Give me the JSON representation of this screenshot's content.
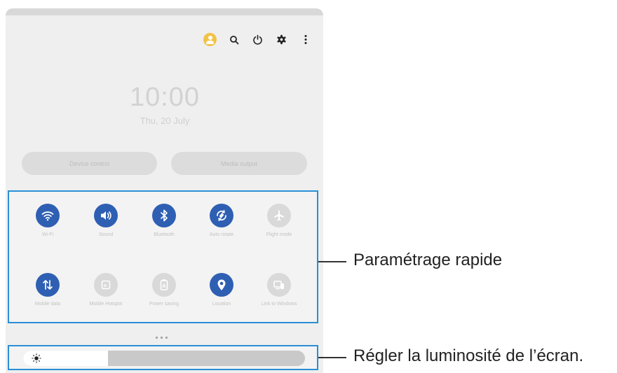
{
  "panel": {
    "top_icons": [
      "account-icon",
      "search-icon",
      "power-icon",
      "settings-gear-icon",
      "more-vertical-icon"
    ],
    "clock": {
      "time": "10:00",
      "date": "Thu, 20 July"
    },
    "buttons": {
      "device_control": "Device control",
      "media_output": "Media output"
    },
    "quick_settings": [
      {
        "label": "Wi-Fi",
        "state": "on",
        "icon": "wifi-icon"
      },
      {
        "label": "Sound",
        "state": "on",
        "icon": "sound-icon"
      },
      {
        "label": "Bluetooth",
        "state": "on",
        "icon": "bluetooth-icon"
      },
      {
        "label": "Auto rotate",
        "state": "on",
        "icon": "auto-rotate-icon"
      },
      {
        "label": "Flight mode",
        "state": "off",
        "icon": "airplane-icon"
      },
      {
        "label": "Mobile data",
        "state": "on",
        "icon": "mobile-data-icon"
      },
      {
        "label": "Mobile Hotspot",
        "state": "off",
        "icon": "hotspot-icon"
      },
      {
        "label": "Power saving",
        "state": "off",
        "icon": "power-saving-icon"
      },
      {
        "label": "Location",
        "state": "on",
        "icon": "location-icon"
      },
      {
        "label": "Link to Windows",
        "state": "off",
        "icon": "link-to-windows-icon"
      }
    ],
    "page_indicator": {
      "pages": 3,
      "current": 0
    },
    "brightness": {
      "level": 0.3
    }
  },
  "callouts": {
    "quick_settings": "Paramétrage rapide",
    "brightness": "Régler la luminosité de l’écran."
  },
  "colors": {
    "accent": "#2e5fb3",
    "highlight_border": "#2a8fd6",
    "avatar": "#f2c246"
  }
}
